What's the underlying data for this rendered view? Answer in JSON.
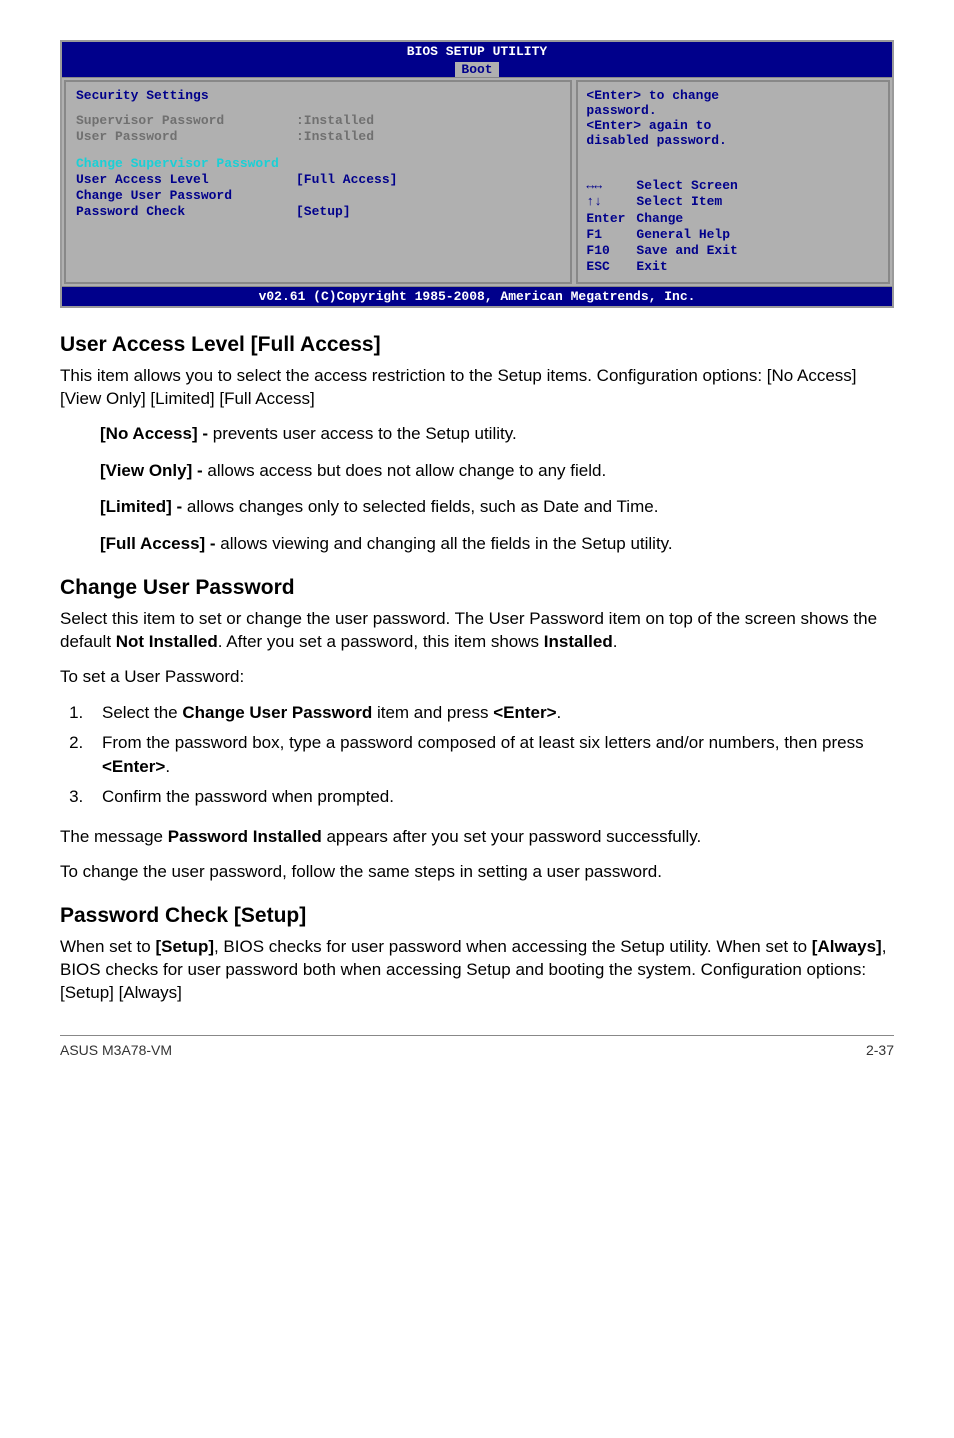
{
  "bios": {
    "title": "BIOS SETUP UTILITY",
    "tab": "Boot",
    "section_title": "Security Settings",
    "rows": {
      "sup_pw_label": "Supervisor Password",
      "sup_pw_value": ":Installed",
      "usr_pw_label": "User Password",
      "usr_pw_value": ":Installed",
      "chg_sup": "Change Supervisor Password",
      "ual_label": "User Access Level",
      "ual_value": "[Full Access]",
      "chg_usr": "Change User Password",
      "pwc_label": "Password Check",
      "pwc_value": "[Setup]"
    },
    "help": {
      "l1": "<Enter> to change",
      "l2": "password.",
      "l3": "<Enter> again to",
      "l4": "disabled password."
    },
    "nav": {
      "select_screen": "Select Screen",
      "select_item": "Select Item",
      "enter_k": "Enter",
      "enter_v": "Change",
      "f1_k": "F1",
      "f1_v": "General Help",
      "f10_k": "F10",
      "f10_v": "Save and Exit",
      "esc_k": "ESC",
      "esc_v": "Exit"
    },
    "footer": "v02.61 (C)Copyright 1985-2008, American Megatrends, Inc."
  },
  "sections": {
    "ual": {
      "heading": "User Access Level [Full Access]",
      "p1": "This item allows you to select the access restriction to the Setup items. Configuration options: [No Access] [View Only] [Limited] [Full Access]",
      "no_access_b": "[No Access] - ",
      "no_access_t": "prevents user access to the Setup utility.",
      "view_only_b": "[View Only] - ",
      "view_only_t": "allows access but does not allow change to any field.",
      "limited_b": "[Limited] - ",
      "limited_t": "allows changes only to selected fields, such as Date and Time.",
      "full_access_b": "[Full Access] - ",
      "full_access_t": "allows viewing and changing all the fields in the Setup utility."
    },
    "cup": {
      "heading": "Change User Password",
      "p1a": "Select this item to set or change the user password. The User Password item on top of the screen shows the default ",
      "p1b": "Not Installed",
      "p1c": ". After you set a password, this item shows ",
      "p1d": "Installed",
      "p1e": ".",
      "p2": "To set a User Password:",
      "step1a": "Select the ",
      "step1b": "Change User Password",
      "step1c": " item and press ",
      "step1d": "<Enter>",
      "step1e": ".",
      "step2a": "From the password box, type a password composed of at least six letters and/or numbers, then press ",
      "step2b": "<Enter>",
      "step2c": ".",
      "step3": "Confirm the password when prompted.",
      "p3a": "The message ",
      "p3b": "Password Installed",
      "p3c": " appears after you set your password successfully.",
      "p4": "To change the user password, follow the same steps in setting a user password."
    },
    "pwc": {
      "heading": "Password Check [Setup]",
      "p1a": "When set to ",
      "p1b": "[Setup]",
      "p1c": ", BIOS checks for user password when accessing the Setup utility. When set to ",
      "p1d": "[Always]",
      "p1e": ", BIOS checks for user password both when accessing Setup and booting the system. Configuration options: [Setup] [Always]"
    }
  },
  "footer": {
    "left": "ASUS M3A78-VM",
    "right": "2-37"
  }
}
